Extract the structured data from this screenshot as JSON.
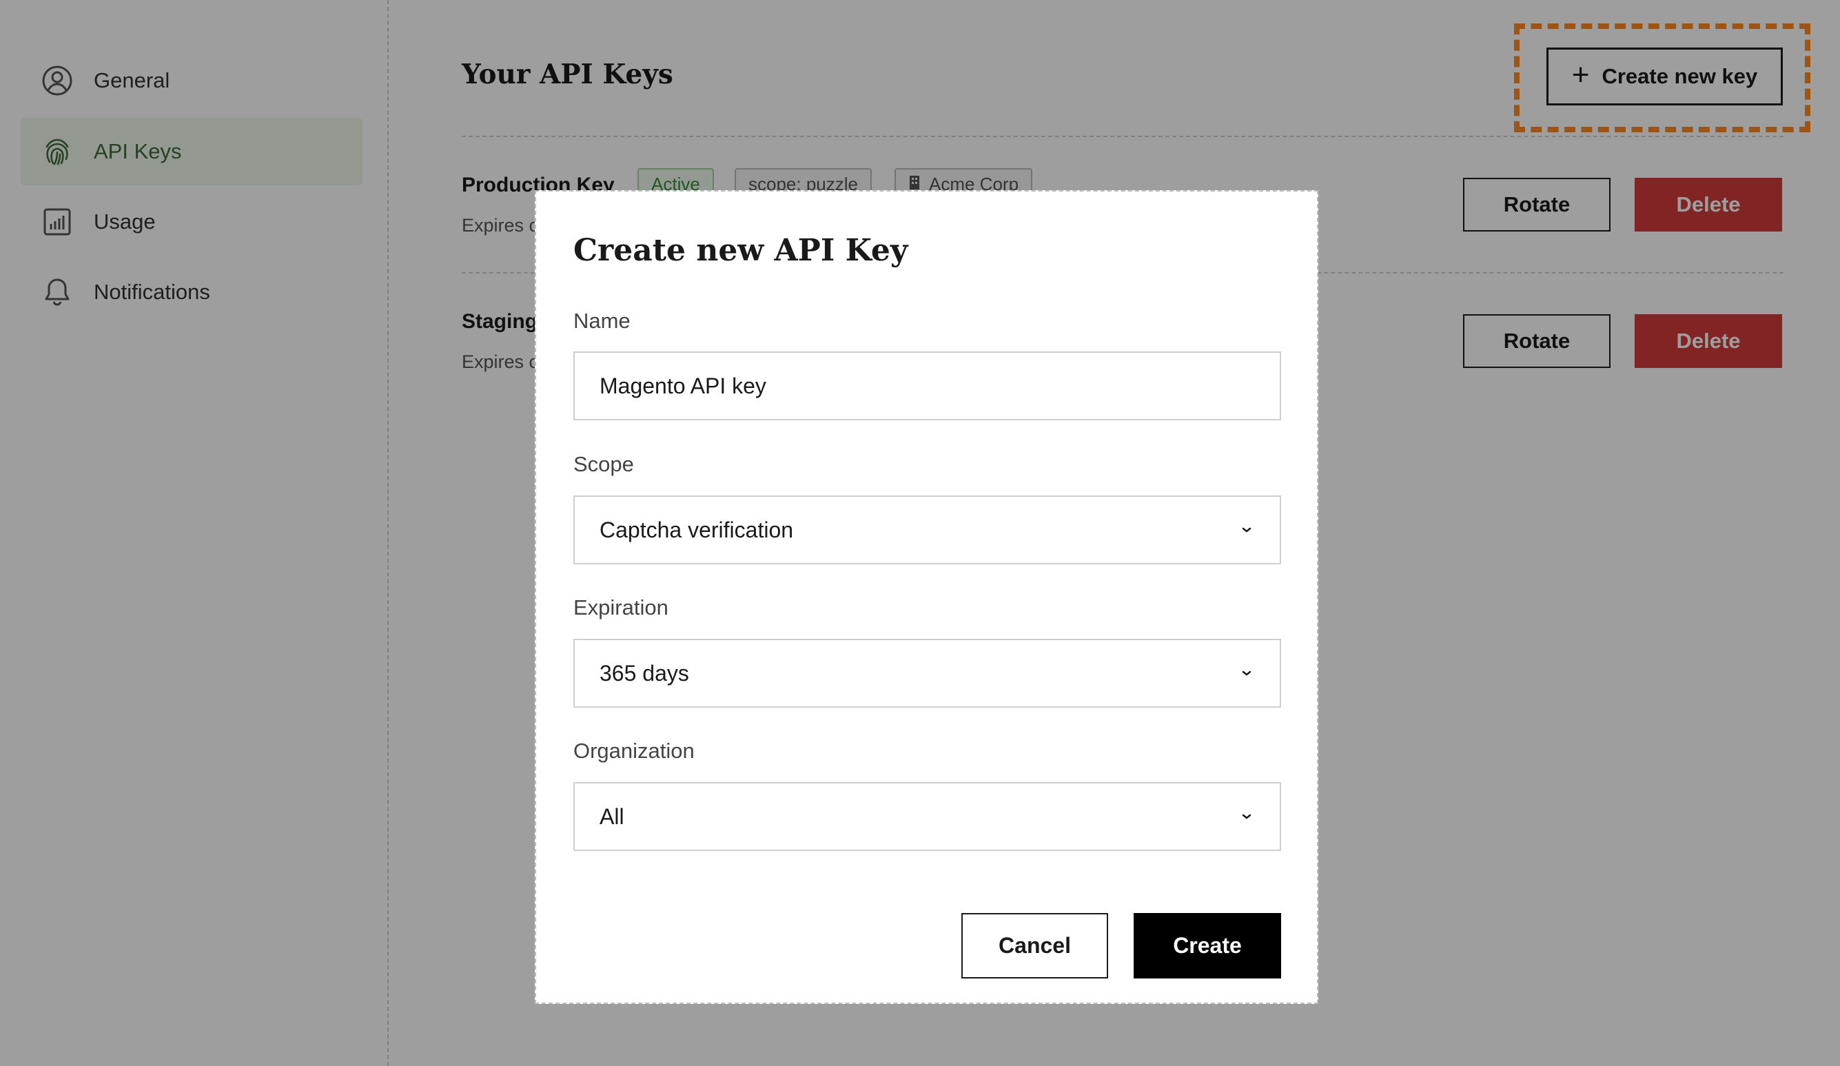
{
  "sidebar": {
    "items": [
      {
        "label": "General",
        "icon": "user-circle-icon"
      },
      {
        "label": "API Keys",
        "icon": "fingerprint-icon",
        "active": true
      },
      {
        "label": "Usage",
        "icon": "bar-chart-icon"
      },
      {
        "label": "Notifications",
        "icon": "bell-icon"
      }
    ]
  },
  "main": {
    "title": "Your API Keys",
    "create_button_label": "Create new key",
    "keys": [
      {
        "name": "Production Key",
        "expires": "Expires c",
        "badges": [
          "Active",
          "scope: puzzle",
          "Acme Corp"
        ],
        "rotate_label": "Rotate",
        "delete_label": "Delete"
      },
      {
        "name": "Staging",
        "expires": "Expires c",
        "rotate_label": "Rotate",
        "delete_label": "Delete"
      }
    ]
  },
  "modal": {
    "title": "Create new API Key",
    "name_label": "Name",
    "name_value": "Magento API key",
    "scope_label": "Scope",
    "scope_value": "Captcha verification",
    "expiration_label": "Expiration",
    "expiration_value": "365 days",
    "organization_label": "Organization",
    "organization_value": "All",
    "cancel_label": "Cancel",
    "create_label": "Create"
  },
  "colors": {
    "highlight": "#ff8a1f",
    "active_nav_bg": "#eef5ea",
    "active_nav_text": "#3d6b3a",
    "delete_bg": "#d33a3a"
  }
}
